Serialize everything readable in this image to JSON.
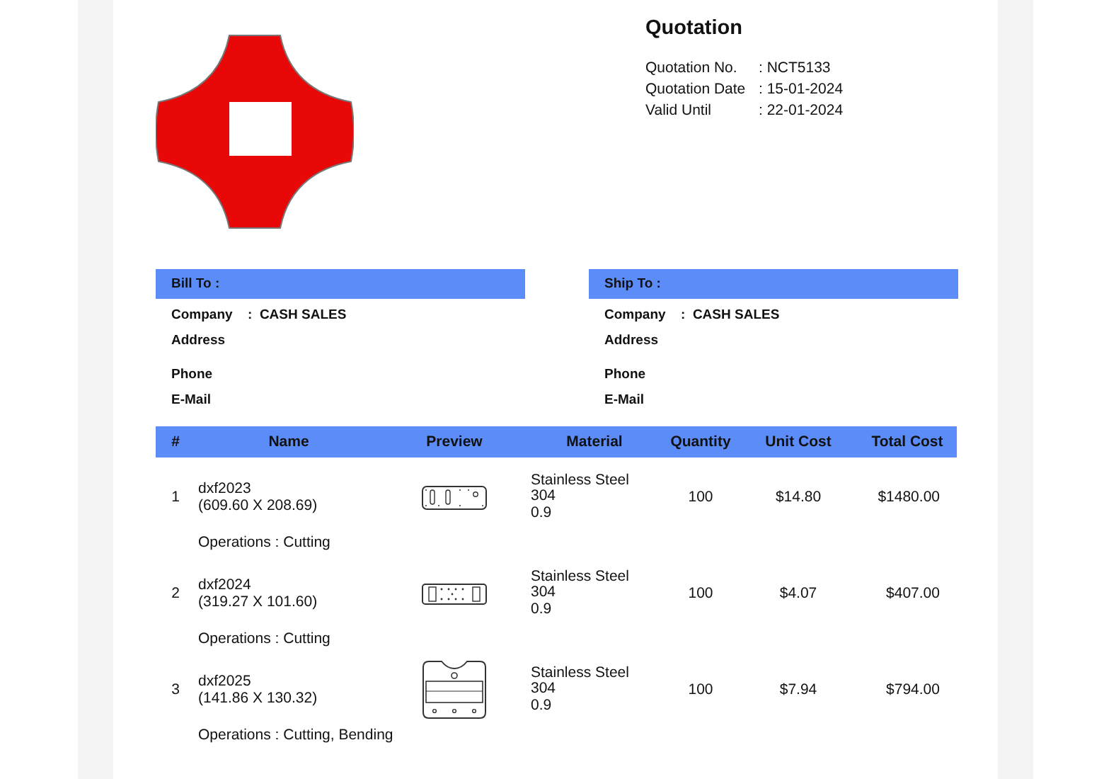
{
  "quotation": {
    "title": "Quotation",
    "fields": [
      {
        "label": "Quotation No.",
        "value": ": NCT5133"
      },
      {
        "label": "Quotation Date",
        "value": ": 15-01-2024"
      },
      {
        "label": "Valid Until",
        "value": ": 22-01-2024"
      }
    ]
  },
  "parties": [
    {
      "title": "Bill To :",
      "company_label": "Company",
      "company": ":  CASH SALES",
      "labels": [
        "Address",
        "Phone",
        "E-Mail"
      ]
    },
    {
      "title": "Ship To :",
      "company_label": "Company",
      "company": ":  CASH SALES",
      "labels": [
        "Address",
        "Phone",
        "E-Mail"
      ]
    }
  ],
  "table": {
    "columns": [
      "#",
      "Name",
      "Preview",
      "Material",
      "Quantity",
      "Unit Cost",
      "Total Cost"
    ],
    "rows": [
      {
        "number": "1",
        "name": "dxf2023",
        "size": "(609.60 X 208.69)",
        "kind": "slotted-plate",
        "material": [
          "Stainless Steel",
          "304",
          "0.9"
        ],
        "quantity": "100",
        "unit_cost": "$14.80",
        "total_cost": "$1480.00",
        "operations": "Operations : Cutting"
      },
      {
        "number": "2",
        "name": "dxf2024",
        "size": "(319.27 X 101.60)",
        "kind": "perforated-plate",
        "material": [
          "Stainless Steel",
          "304",
          "0.9"
        ],
        "quantity": "100",
        "unit_cost": "$4.07",
        "total_cost": "$407.00",
        "operations": "Operations : Cutting"
      },
      {
        "number": "3",
        "name": "dxf2025",
        "size": "(141.86 X 130.32)",
        "kind": "bracket",
        "material": [
          "Stainless Steel",
          "304",
          "0.9"
        ],
        "quantity": "100",
        "unit_cost": "$7.94",
        "total_cost": "$794.00",
        "operations": "Operations : Cutting, Bending"
      }
    ]
  }
}
